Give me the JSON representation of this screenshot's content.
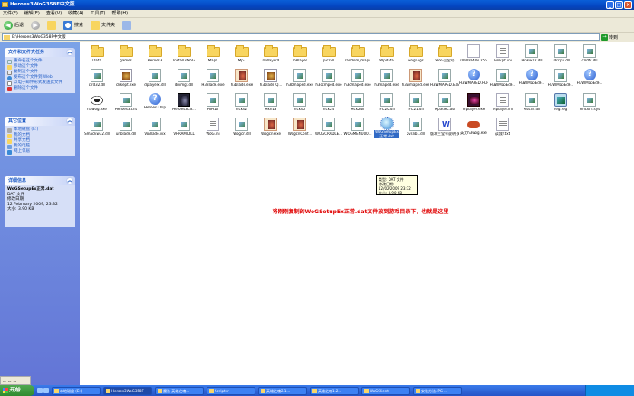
{
  "window": {
    "title": "Heroes3WoG358F中文版"
  },
  "menu": [
    "文件(F)",
    "编辑(E)",
    "查看(V)",
    "收藏(A)",
    "工具(T)",
    "帮助(H)"
  ],
  "toolbar": {
    "back": "后退",
    "search": "搜索",
    "folders": "文件夹"
  },
  "address": {
    "value": "E:\\Heroes3WoG358F中文版",
    "go": "转到"
  },
  "sidebar": {
    "tasks_title": "文件和文件夹任务",
    "tasks": [
      "重命名这个文件",
      "移动这个文件",
      "复制这个文件",
      "发布这个文件到 Web",
      "以电子邮件形式发送此文件",
      "删除这个文件"
    ],
    "places_title": "其它位置",
    "places": [
      "本地磁盘 (E:)",
      "我的文档",
      "共享文档",
      "我的电脑",
      "网上邻居"
    ],
    "details_title": "详细信息",
    "details": {
      "name": "WoGSetupEx正常.dat",
      "type": "DAT 文件",
      "modified_label": "修改日期:",
      "modified": "12 February 2009, 23:32",
      "size": "大小: 3.90 KB"
    }
  },
  "files": [
    {
      "name": "Data",
      "icon": "folder"
    },
    {
      "name": "games",
      "icon": "folder"
    },
    {
      "name": "Heroes3",
      "icon": "folder"
    },
    {
      "name": "Install3WoG",
      "icon": "folder"
    },
    {
      "name": "Maps",
      "icon": "folder"
    },
    {
      "name": "Mp3",
      "icon": "folder"
    },
    {
      "name": "mPlayerX",
      "icon": "folder"
    },
    {
      "name": "mPlayer",
      "icon": "folder"
    },
    {
      "name": "picrall",
      "icon": "folder"
    },
    {
      "name": "random_maps",
      "icon": "folder"
    },
    {
      "name": "Wpdata",
      "icon": "folder"
    },
    {
      "name": "wogLogs",
      "icon": "folder"
    },
    {
      "name": "WoG三宝号",
      "icon": "folder"
    },
    {
      "name": "00000409.256",
      "icon": "dat"
    },
    {
      "name": "binkplt.ini",
      "icon": "ini"
    },
    {
      "name": "Binkw32.dll",
      "icon": "dll"
    },
    {
      "name": "Cdrcpu.dll",
      "icon": "dll"
    },
    {
      "name": "clrdfc.dll",
      "icon": "dll"
    },
    {
      "name": "clrd32.dll",
      "icon": "dll"
    },
    {
      "name": "clrkept.exe",
      "icon": "exe"
    },
    {
      "name": "dplayerx.dll",
      "icon": "dll"
    },
    {
      "name": "drvmgt.dll",
      "icon": "dll"
    },
    {
      "name": "H3Blade.exe",
      "icon": "dll"
    },
    {
      "name": "h3blade.exe",
      "icon": "wiz"
    },
    {
      "name": "h3blade Q...",
      "icon": "exe"
    },
    {
      "name": "h3bmaped.exe",
      "icon": "dll"
    },
    {
      "name": "h3ccmped.exe",
      "icon": "dll"
    },
    {
      "name": "h3cmaped.exe",
      "icon": "dll"
    },
    {
      "name": "h3maped.exe",
      "icon": "dll"
    },
    {
      "name": "h3wmaped.exe",
      "icon": "wiz"
    },
    {
      "name": "H3WMAPED.EXE",
      "icon": "dll"
    },
    {
      "name": "H3WMAPED.HLP",
      "icon": "help"
    },
    {
      "name": "H3WMapEdF...",
      "icon": "dll"
    },
    {
      "name": "H3WMapEdF...",
      "icon": "help"
    },
    {
      "name": "H3WMapEdF...",
      "icon": "dll"
    },
    {
      "name": "H3WMapEdF...",
      "icon": "help"
    },
    {
      "name": "h3wog.exe",
      "icon": "eye"
    },
    {
      "name": "Heroes3.cnt",
      "icon": "dll"
    },
    {
      "name": "Heroes3.hlp",
      "icon": "help"
    },
    {
      "name": "Heroes3CS...",
      "icon": "dark"
    },
    {
      "name": "HIH10",
      "icon": "dll"
    },
    {
      "name": "hckd2",
      "icon": "dll"
    },
    {
      "name": "Hkh13",
      "icon": "dll"
    },
    {
      "name": "hckd5",
      "icon": "dll"
    },
    {
      "name": "hck24",
      "icon": "dll"
    },
    {
      "name": "Hck24k",
      "icon": "dll"
    },
    {
      "name": "IFC20.dll",
      "icon": "dll"
    },
    {
      "name": "IFC21.dll",
      "icon": "dll"
    },
    {
      "name": "Mp3dec.asi",
      "icon": "dll"
    },
    {
      "name": "mplayer.exe",
      "icon": "purple"
    },
    {
      "name": "Mplayer.ini",
      "icon": "ini"
    },
    {
      "name": "Mss32.dll",
      "icon": "dll"
    },
    {
      "name": "reg.reg",
      "icon": "reg"
    },
    {
      "name": "smckrn.sys",
      "icon": "dll"
    },
    {
      "name": "Smackw32.dll",
      "icon": "dll"
    },
    {
      "name": "unblade.dll",
      "icon": "dll"
    },
    {
      "name": "VoBlade.ivx",
      "icon": "dll"
    },
    {
      "name": "VHRAM.DLL",
      "icon": "dll"
    },
    {
      "name": "WoG.ini",
      "icon": "ini"
    },
    {
      "name": "Wogcn.dll",
      "icon": "dll"
    },
    {
      "name": "Wogcn.exe",
      "icon": "wiz"
    },
    {
      "name": "WogcnConf...",
      "icon": "wiz"
    },
    {
      "name": "WOGCRADLE...",
      "icon": "dll"
    },
    {
      "name": "WOGMENU00...",
      "icon": "dll"
    },
    {
      "name": "WoGSetupEx正常.dat",
      "icon": "globe",
      "selected": true
    },
    {
      "name": "zvslib1.dll",
      "icon": "dll"
    },
    {
      "name": "版本三宝号说明-关联项",
      "icon": "doc"
    },
    {
      "name": "英文h3wog.exe",
      "icon": "key"
    },
    {
      "name": "读我!.txt",
      "icon": "txt"
    }
  ],
  "tooltip": {
    "type": "类型: DAT 文件",
    "modified": "修改日期: 12/02/2009 23:32",
    "size": "大小: 3.90 KB"
  },
  "annotation": "将刚刚复制的WoGSetupEx正常.dat文件放到游戏目录下，也就是这里",
  "taskbar": {
    "start": "开始",
    "tasks": [
      "本地磁盘 (E:)",
      "Heroes3WoG358F",
      "魔法 英雄之魂...",
      "Scripter",
      "英雄之魂2.1...",
      "英雄之魂1.2...",
      "WoGClient",
      "安装方法.JPG ..."
    ]
  }
}
